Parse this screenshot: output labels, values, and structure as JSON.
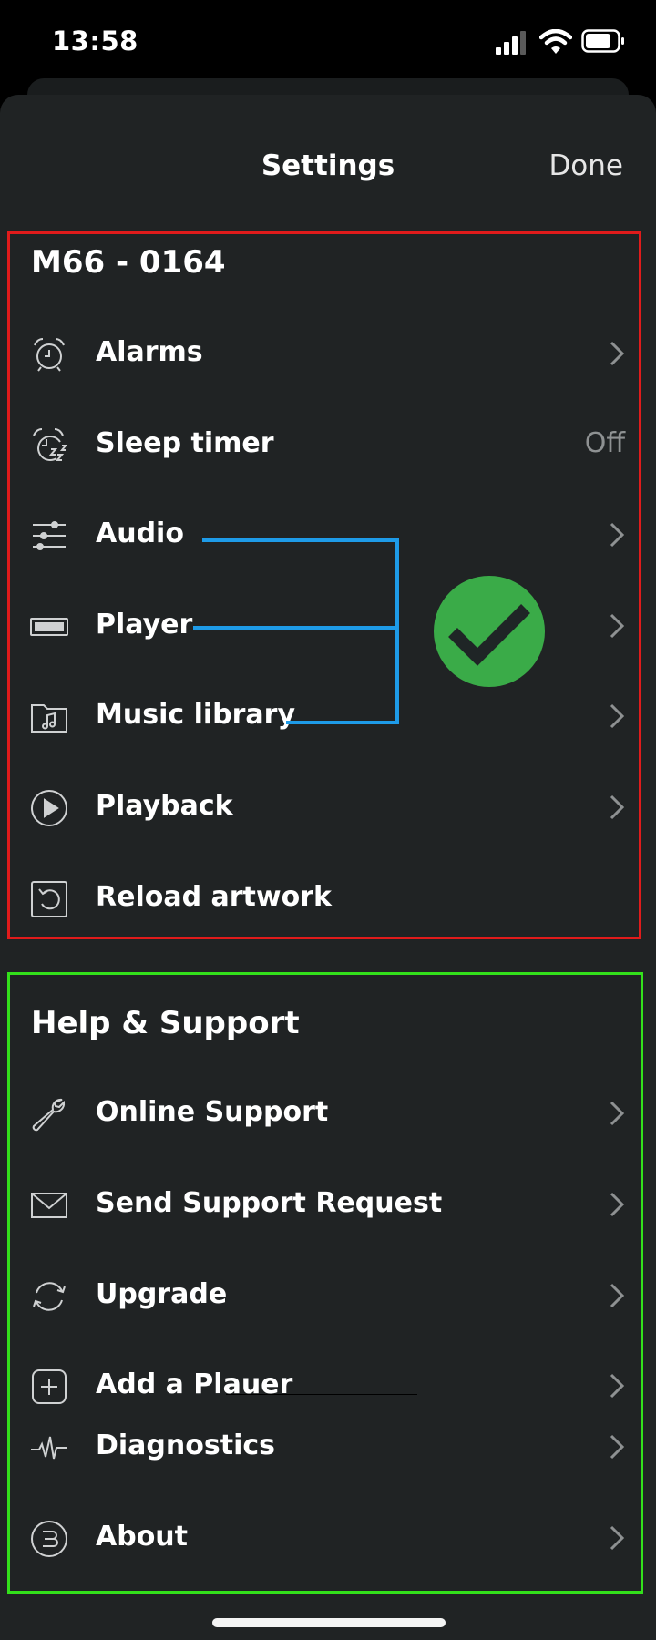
{
  "status_bar": {
    "time": "13:58"
  },
  "nav": {
    "title": "Settings",
    "done_label": "Done"
  },
  "device_section": {
    "title": "M66 - 0164",
    "items": [
      {
        "icon": "alarm-clock-icon",
        "label": "Alarms"
      },
      {
        "icon": "sleep-timer-icon",
        "label": "Sleep timer",
        "value": "Off"
      },
      {
        "icon": "sliders-icon",
        "label": "Audio"
      },
      {
        "icon": "player-device-icon",
        "label": "Player"
      },
      {
        "icon": "music-folder-icon",
        "label": "Music library"
      },
      {
        "icon": "play-circle-icon",
        "label": "Playback"
      },
      {
        "icon": "reload-icon",
        "label": "Reload artwork"
      }
    ]
  },
  "help_section": {
    "title": "Help & Support",
    "items": [
      {
        "icon": "wrench-icon",
        "label": "Online Support"
      },
      {
        "icon": "envelope-icon",
        "label": "Send Support Request"
      },
      {
        "icon": "sync-arrows-icon",
        "label": "Upgrade"
      },
      {
        "icon": "plus-square-icon",
        "label": "Add a Plauer"
      },
      {
        "icon": "pulse-icon",
        "label": "Diagnostics"
      },
      {
        "icon": "brand-logo-icon",
        "label": "About"
      }
    ]
  },
  "colors": {
    "background": "#202324",
    "red_box": "#e01b1b",
    "green_box": "#33e01b",
    "annotation_line": "#1e9be8",
    "checkmark_circle": "#3aab48"
  }
}
